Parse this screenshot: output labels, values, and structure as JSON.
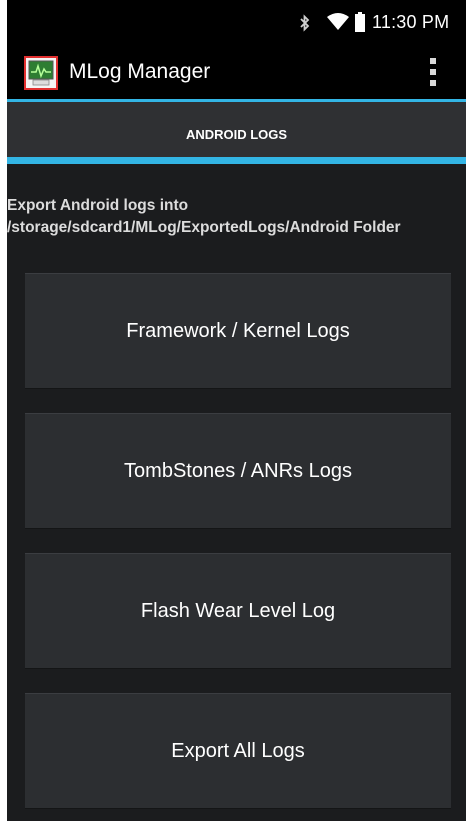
{
  "status_bar": {
    "time": "11:30 PM",
    "icons": [
      "bluetooth-icon",
      "wifi-icon",
      "battery-icon"
    ]
  },
  "action_bar": {
    "app_icon": "app-logo-icon",
    "title": "MLog Manager",
    "menu_icon": "overflow-menu-icon"
  },
  "tab": {
    "label": "ANDROID LOGS"
  },
  "description": "Export Android logs into /storage/sdcard1/MLog/ExportedLogs/Android Folder",
  "buttons": {
    "framework": "Framework / Kernel Logs",
    "tombstones": "TombStones / ANRs Logs",
    "flash": "Flash Wear Level Log",
    "export_all": "Export All Logs"
  },
  "colors": {
    "accent": "#33b5e5",
    "background": "#1b1c1e",
    "button": "#2c2e31",
    "app_icon_border": "#e23030"
  }
}
